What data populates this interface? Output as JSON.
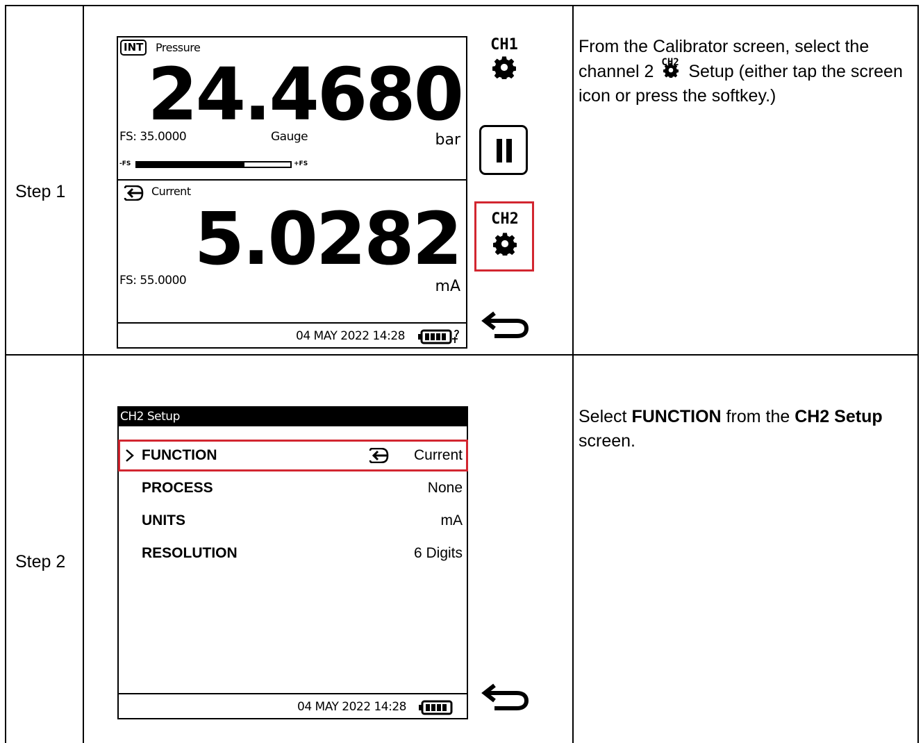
{
  "steps": [
    {
      "label": "Step 1",
      "instruction": {
        "pre": "From the Calibrator screen, select the channel 2",
        "icon_label": "CH2",
        "post": "Setup (either tap the screen icon or press the softkey.)"
      },
      "device": {
        "ch1": {
          "source_badge": "INT",
          "function": "Pressure",
          "value": "24.4680",
          "fs": "FS: 35.0000",
          "mode": "Gauge",
          "unit": "bar",
          "bar_min": "-FS",
          "bar_max": "+FS",
          "bar_fill_fraction": 0.7
        },
        "ch2": {
          "function": "Current",
          "value": "5.0282",
          "fs": "FS: 55.0000",
          "unit": "mA"
        },
        "status_datetime": "04 MAY 2022 14:28",
        "softkeys": {
          "ch1": "CH1",
          "ch2": "CH2"
        }
      }
    },
    {
      "label": "Step 2",
      "instruction": {
        "pre": "Select",
        "bold1": "FUNCTION",
        "mid": "from the",
        "bold2": "CH2 Setup",
        "post": "screen."
      },
      "device": {
        "title": "CH2 Setup",
        "menu": [
          {
            "label": "FUNCTION",
            "value": "Current",
            "selected": true
          },
          {
            "label": "PROCESS",
            "value": "None"
          },
          {
            "label": "UNITS",
            "value": "mA"
          },
          {
            "label": "RESOLUTION",
            "value": "6 Digits"
          }
        ],
        "status_datetime": "04 MAY 2022 14:28"
      }
    }
  ],
  "colors": {
    "highlight": "#d22630",
    "title_bar": "#000000"
  },
  "icons": [
    "gear-icon",
    "pause-icon",
    "back-arrow-icon",
    "input-arrow-icon",
    "battery-icon",
    "chevron-right-icon"
  ]
}
